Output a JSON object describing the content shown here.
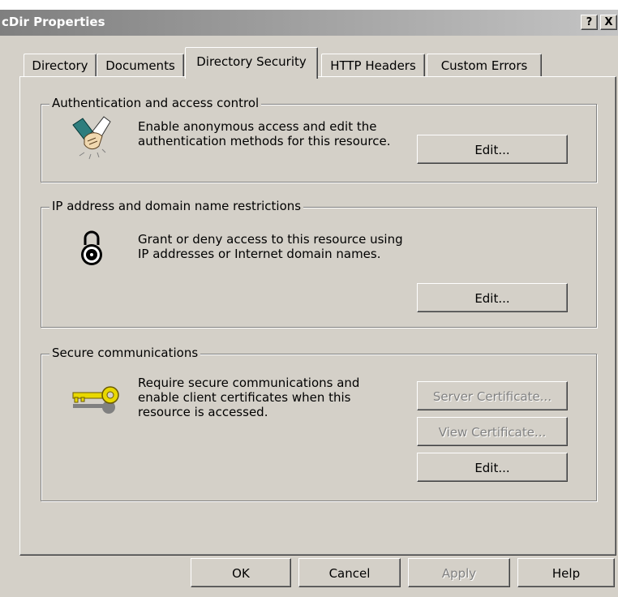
{
  "window": {
    "title": "cDir Properties",
    "help_button": "?",
    "close_button": "X"
  },
  "tabs": [
    {
      "label": "Directory"
    },
    {
      "label": "Documents"
    },
    {
      "label": "Directory Security",
      "active": true
    },
    {
      "label": "HTTP Headers"
    },
    {
      "label": "Custom Errors"
    }
  ],
  "auth": {
    "legend": "Authentication and access control",
    "line1": "Enable anonymous access and edit the",
    "line2": "authentication methods for this resource.",
    "edit_label": "Edit..."
  },
  "ip": {
    "legend": "IP address and domain name restrictions",
    "line1": "Grant or deny access to this resource using",
    "line2": "IP addresses or Internet domain names.",
    "edit_label": "Edit..."
  },
  "secure": {
    "legend": "Secure communications",
    "line1": "Require secure communications and",
    "line2": "enable client certificates when this",
    "line3": "resource is accessed.",
    "server_cert_label": "Server Certificate...",
    "view_cert_label": "View Certificate...",
    "edit_label": "Edit..."
  },
  "footer": {
    "ok_label": "OK",
    "cancel_label": "Cancel",
    "apply_label": "Apply",
    "help_label": "Help"
  },
  "colors": {
    "face": "#d4d0c8",
    "disabled_text": "#808080"
  },
  "icons": {
    "auth": "handshake-icon",
    "ip": "padlock-icon",
    "secure": "key-icon"
  }
}
